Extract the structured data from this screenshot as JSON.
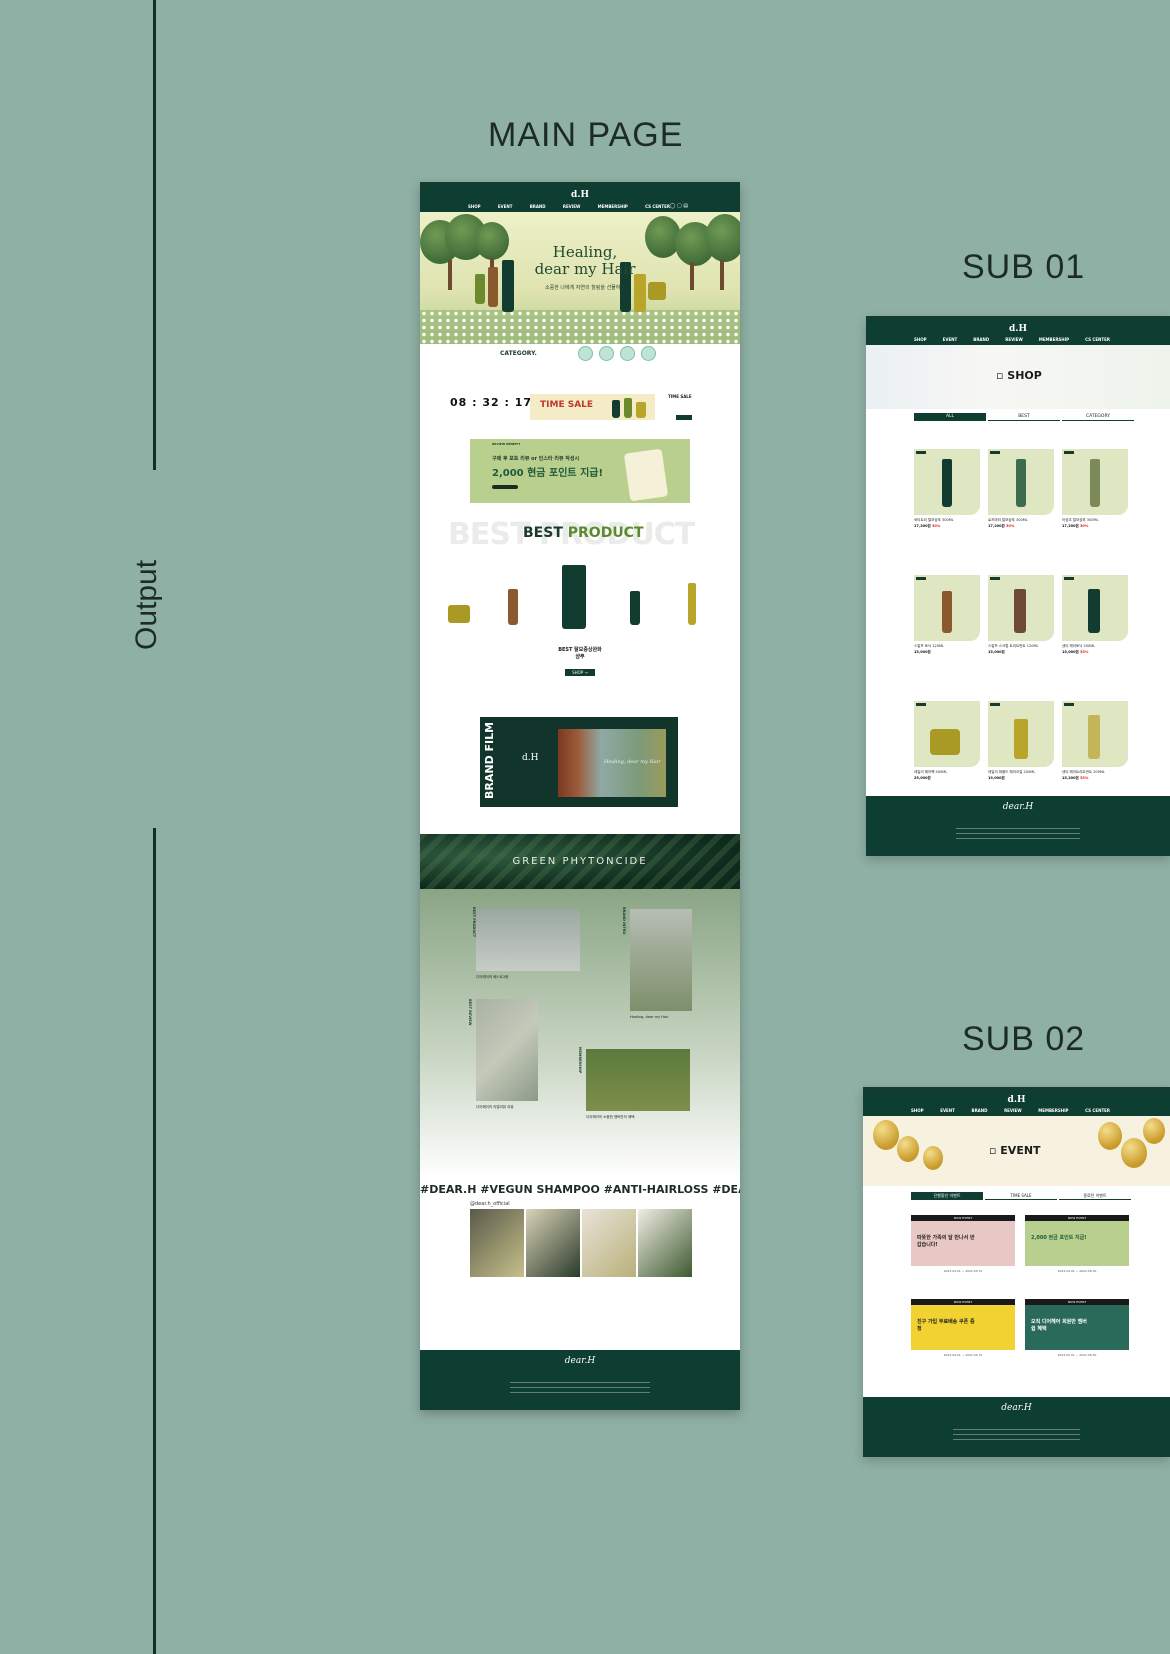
{
  "labels": {
    "output": "Output",
    "main": "MAIN PAGE",
    "sub01": "SUB 01",
    "sub02": "SUB 02"
  },
  "main": {
    "nav": {
      "links": [
        "SHOP",
        "EVENT",
        "BRAND",
        "REVIEW",
        "MEMBERSHIP",
        "CS CENTER"
      ]
    },
    "hero": {
      "title_line1": "Healing,",
      "title_line2": "dear my Hair",
      "subtitle": "소중한 나에게 자연의 힐링을 선물하다"
    },
    "category": {
      "title": "CATEGORY."
    },
    "timesale": {
      "hours": "08",
      "minutes": "32",
      "seconds": "17",
      "banner": "TIME SALE",
      "side_title": "TIME SALE"
    },
    "review": {
      "tag": "REVIEW BENEFIT",
      "line1": "구매 후 포토 리뷰 or 인스타 리뷰 작성시",
      "line2": "2,000 현금 포인트 지급!"
    },
    "best": {
      "bg_text": "BEST PRODUCT",
      "title_a": "BEST",
      "title_b": "PRODUCT",
      "name_line1": "BEST 탈모증상완화",
      "name_line2": "샴푸",
      "button": "SHOP →"
    },
    "film": {
      "label": "BRAND FILM",
      "caption": "Healing, dear my Hair"
    },
    "green": {
      "title": "GREEN  PHYTONCIDE"
    },
    "collage": {
      "items": [
        {
          "label": "BEST PRODUCT",
          "caption": "디어헤어의 베스트3종"
        },
        {
          "label": "BRAND INTRO",
          "caption": "Healing, dear my Hair"
        },
        {
          "label": "BEST REVIEW",
          "caption": "디어헤어의 리얼리뷰 리뷰"
        },
        {
          "label": "MEMBERSHIP",
          "caption": "디어헤어의 소중한 멤버만의 혜택"
        }
      ]
    },
    "hashtags": "#DEAR.H  #VEGUN SHAMPOO  #ANTI-HAIRLOSS  #DEAR.H  #VEGUN",
    "instagram": {
      "handle": "@dear.h_official"
    },
    "footer": {
      "logo": "dear.H"
    }
  },
  "sub1": {
    "hero_title": "SHOP",
    "tabs": [
      "ALL",
      "BEST",
      "CATEGORY"
    ],
    "products": [
      {
        "name": "쑥티트리 탈모샴푸 300ML",
        "price": "17,200원",
        "discount": "30%"
      },
      {
        "name": "로즈마리 탈모샴푸 300ML",
        "price": "17,200원",
        "discount": "30%"
      },
      {
        "name": "어성초 탈모샴푸 300ML",
        "price": "17,200원",
        "discount": "30%"
      },
      {
        "name": "스칼프 토닉 120ML",
        "price": "15,000원",
        "discount": ""
      },
      {
        "name": "스칼프 스크럽 트리트먼트 120ML",
        "price": "15,000원",
        "discount": ""
      },
      {
        "name": "센티 헤어토닉 200ML",
        "price": "15,000원",
        "discount": "35%"
      },
      {
        "name": "데일리 헤어팩 500ML",
        "price": "25,000원",
        "discount": ""
      },
      {
        "name": "데일리 퍼퓸드 헤어오일 200ML",
        "price": "19,000원",
        "discount": ""
      },
      {
        "name": "센티 헤어트리트먼트 200ML",
        "price": "15,200원",
        "discount": "35%"
      }
    ]
  },
  "sub2": {
    "hero_title": "EVENT",
    "tabs": [
      "진행중인 이벤트",
      "TIME SALE",
      "종료된 이벤트"
    ],
    "events": [
      {
        "top": "NOW EVENT",
        "text": "따뜻한 가족의 달 만나서 반갑습니다!",
        "date": "2022.04.01 ~ 2022.05.31"
      },
      {
        "top": "NOW EVENT",
        "text": "2,000 현금 포인트 지급!",
        "date": "2022.04.01 ~ 2022.06.30"
      },
      {
        "top": "NOW EVENT",
        "text": "친구 가입 무료배송 쿠폰 증정",
        "date": "2022.04.01 ~ 2022.05.31"
      },
      {
        "top": "NOW EVENT",
        "text": "오직 디어헤어 회원만 멤버쉽 혜택",
        "date": "2022.05.01 ~ 2022.06.30"
      }
    ]
  }
}
